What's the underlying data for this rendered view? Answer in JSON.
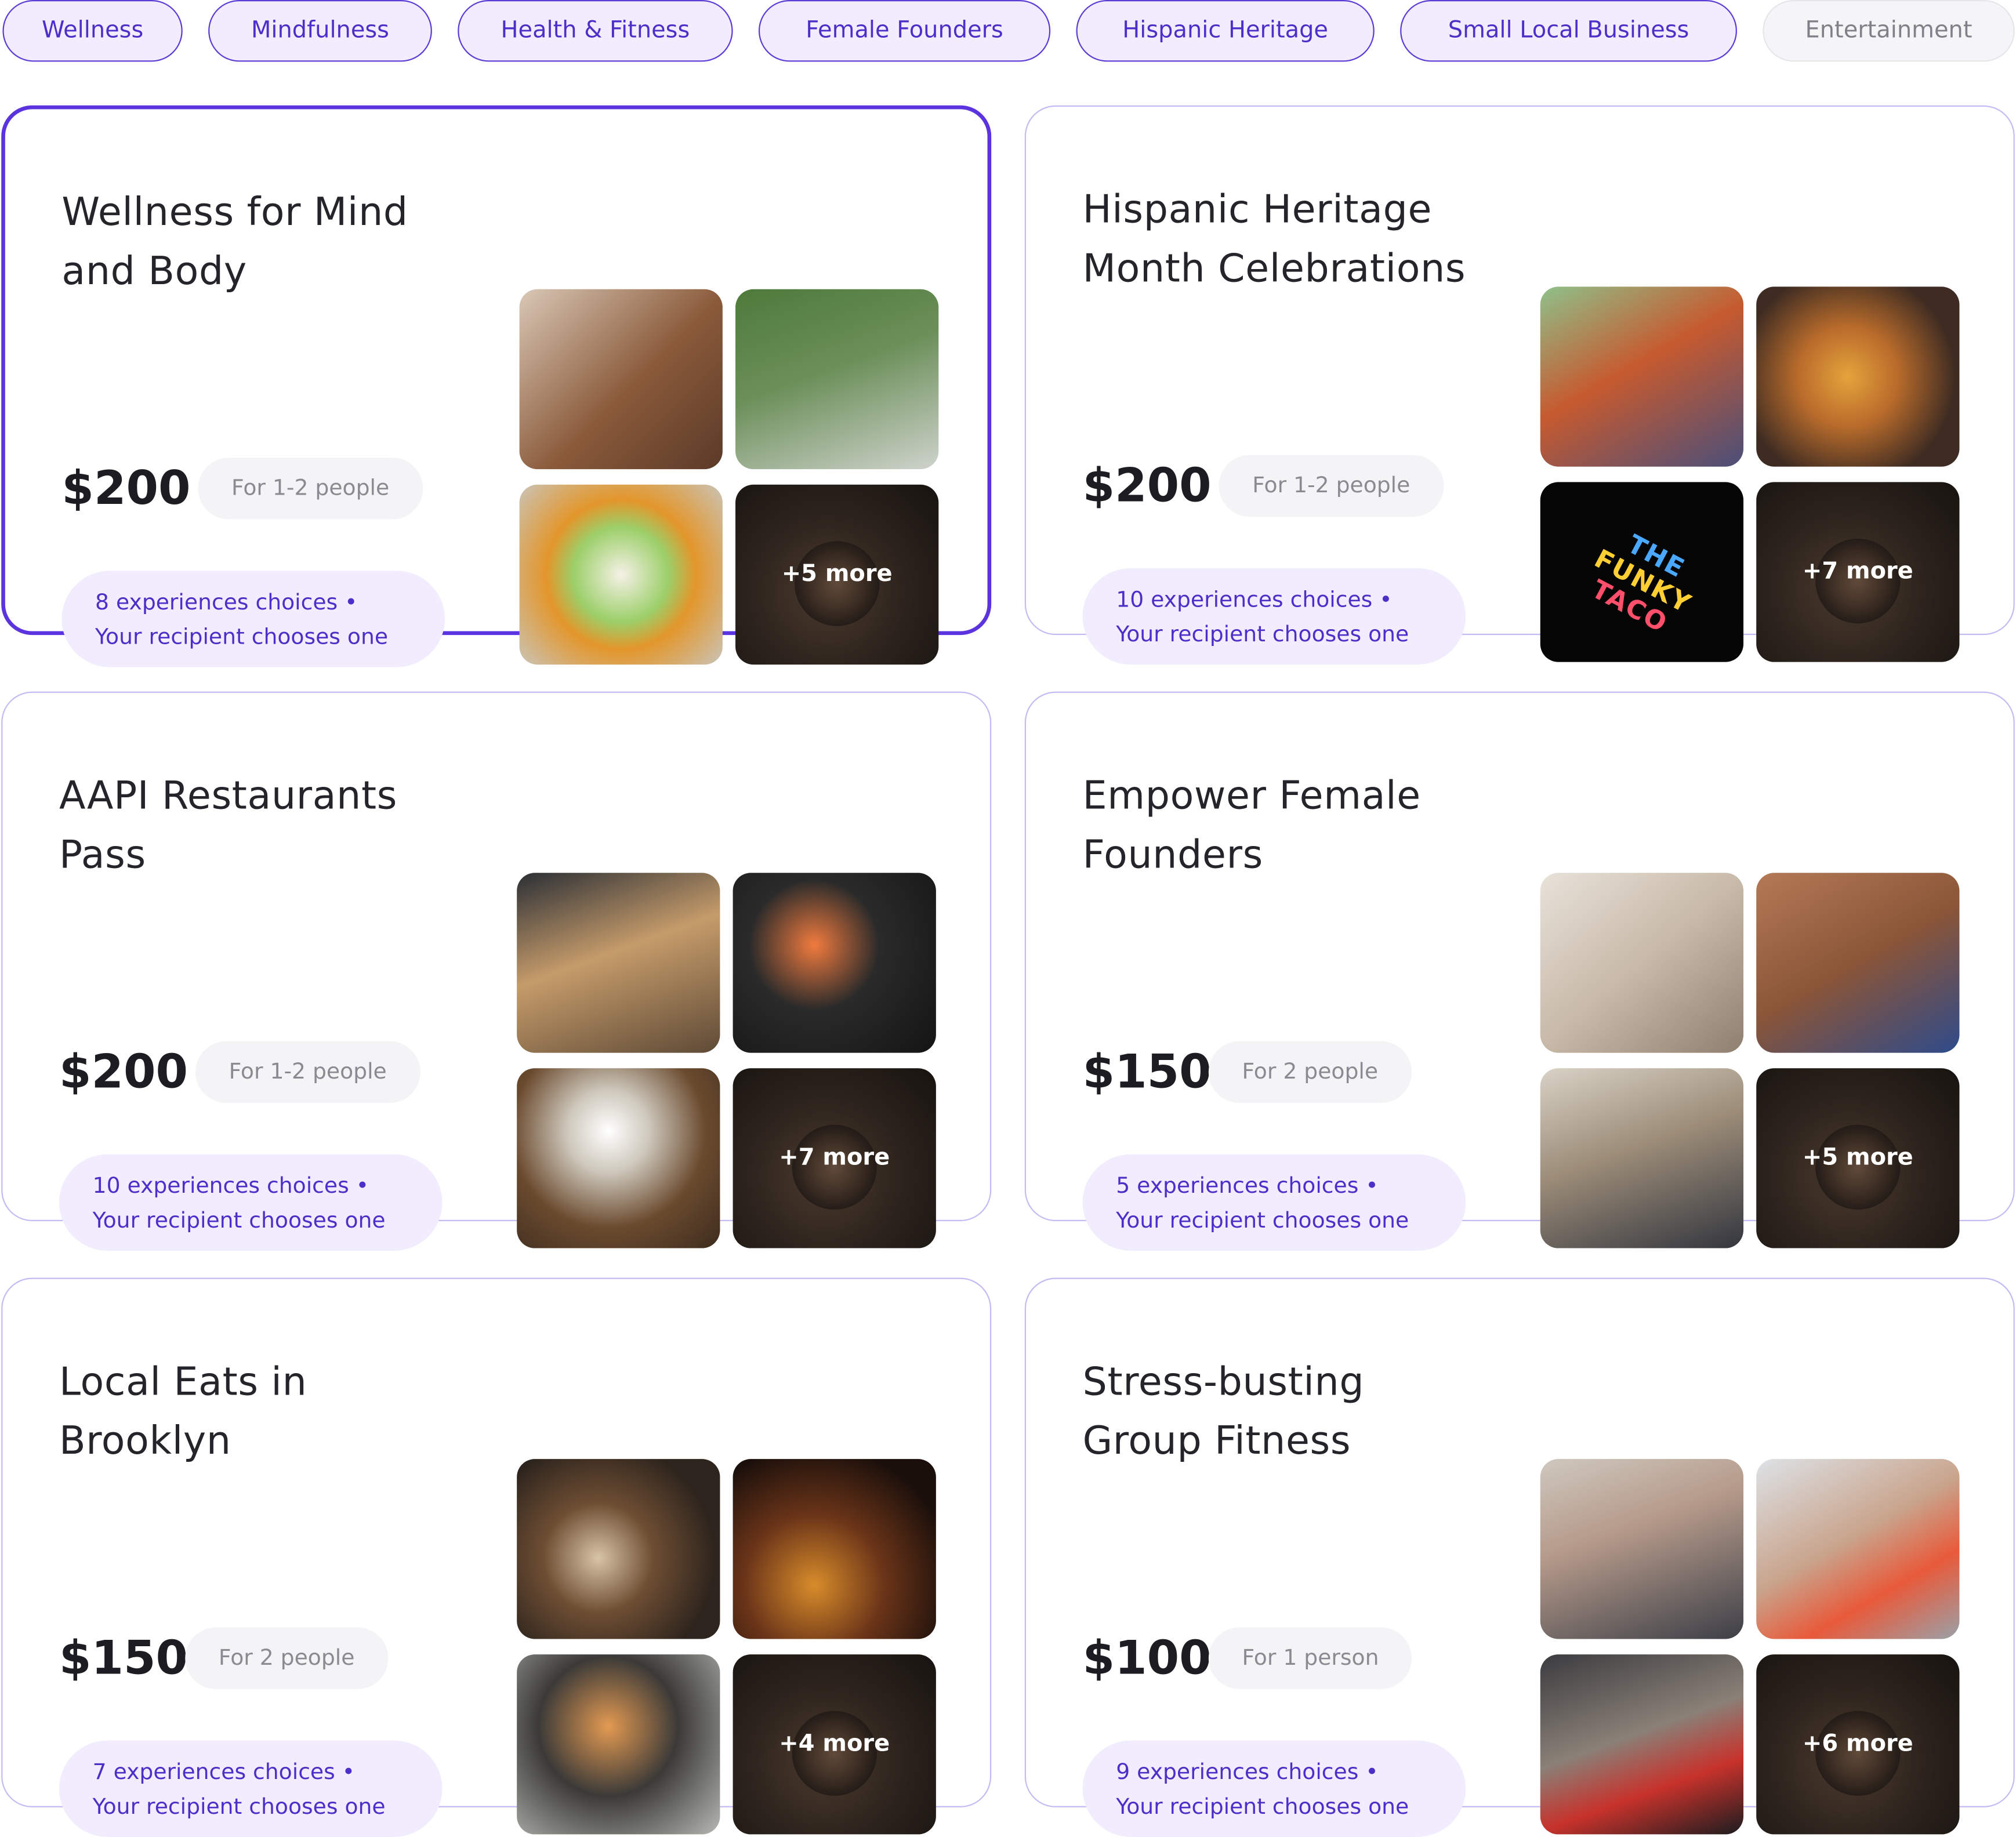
{
  "filters": [
    {
      "label": "Wellness",
      "active": true
    },
    {
      "label": "Mindfulness",
      "active": true
    },
    {
      "label": "Health & Fitness",
      "active": true
    },
    {
      "label": "Female Founders",
      "active": true
    },
    {
      "label": "Hispanic Heritage",
      "active": true
    },
    {
      "label": "Small Local Business",
      "active": true
    },
    {
      "label": "Entertainment",
      "active": false
    }
  ],
  "cards": [
    {
      "title": "Wellness for Mind and Body",
      "price": "$200",
      "people": "For 1-2 people",
      "experiences": "8 experiences choices •",
      "chooses": "Your recipient chooses one",
      "more": "+5 more",
      "selected": true
    },
    {
      "title": "Hispanic Heritage Month Celebrations",
      "price": "$200",
      "people": "For 1-2 people",
      "experiences": "10 experiences choices •",
      "chooses": "Your recipient chooses one",
      "more": "+7 more",
      "neon_sign": [
        "THE",
        "FUNKY",
        "TACO"
      ],
      "selected": false
    },
    {
      "title": "AAPI Restaurants Pass",
      "price": "$200",
      "people": "For 1-2 people",
      "experiences": "10 experiences choices •",
      "chooses": "Your recipient chooses one",
      "more": "+7 more",
      "selected": false
    },
    {
      "title": "Empower Female Founders",
      "price": "$150",
      "people": "For 2 people",
      "experiences": "5 experiences choices •",
      "chooses": "Your recipient chooses one",
      "more": "+5 more",
      "selected": false
    },
    {
      "title": "Local Eats in Brooklyn",
      "price": "$150",
      "people": "For 2 people",
      "experiences": "7 experiences choices •",
      "chooses": "Your recipient chooses one",
      "more": "+4 more",
      "selected": false
    },
    {
      "title": "Stress-busting Group Fitness",
      "price": "$100",
      "people": "For 1 person",
      "experiences": "9 experiences choices •",
      "chooses": "Your recipient chooses one",
      "more": "+6 more",
      "selected": false
    }
  ],
  "colors": {
    "accent": "#5b34df",
    "chip_bg": "#f1ecfe",
    "chip_text": "#4a2fc9",
    "card_border": "#c7b9f4",
    "people_pill_bg": "#f4f4f6"
  }
}
